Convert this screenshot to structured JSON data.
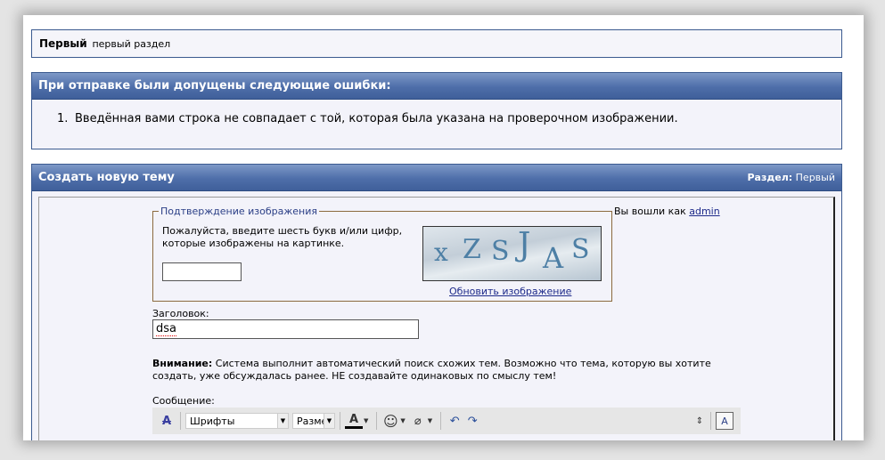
{
  "breadcrumb": {
    "forum": "Первый",
    "description": "первый раздел"
  },
  "errors": {
    "title": "При отправке были допущены следующие ошибки:",
    "items": [
      {
        "num": "1.",
        "text": "Введённая вами строка не совпадает с той, которая была указана на проверочном изображении."
      }
    ]
  },
  "topic": {
    "title": "Создать новую тему",
    "section_label": "Раздел:",
    "section_value": "Первый"
  },
  "captcha": {
    "legend": "Подтверждение изображения",
    "instructions": "Пожалуйста, введите шесть букв и/или цифр, которые изображены на картинке.",
    "input_value": "",
    "image_letters": [
      "x",
      "Z",
      "S",
      "J",
      "A",
      "S"
    ],
    "refresh_link": "Обновить изображение"
  },
  "user": {
    "logged_in_as": "Вы вошли как",
    "username": "admin"
  },
  "form": {
    "title_label": "Заголовок:",
    "title_value": "dsa",
    "notice_bold": "Внимание:",
    "notice_text": " Система выполнит автоматический поиск схожих тем. Возможно что тема, которую вы хотите создать, уже обсуждалась ранее. НЕ создавайте одинаковых по смыслу тем!",
    "message_label": "Сообщение:"
  },
  "toolbar": {
    "font_select": "Шрифты",
    "size_select": "Разме",
    "icons": [
      "format-icon",
      "font-color-icon",
      "smiley-icon",
      "attach-icon",
      "undo-icon",
      "redo-icon",
      "resize-icon",
      "source-mode-icon"
    ]
  },
  "colors": {
    "header_bar": "#4e6ea9",
    "border": "#3b5a8f",
    "link": "#1d2a8a",
    "captcha_border": "#8b6a3e"
  }
}
